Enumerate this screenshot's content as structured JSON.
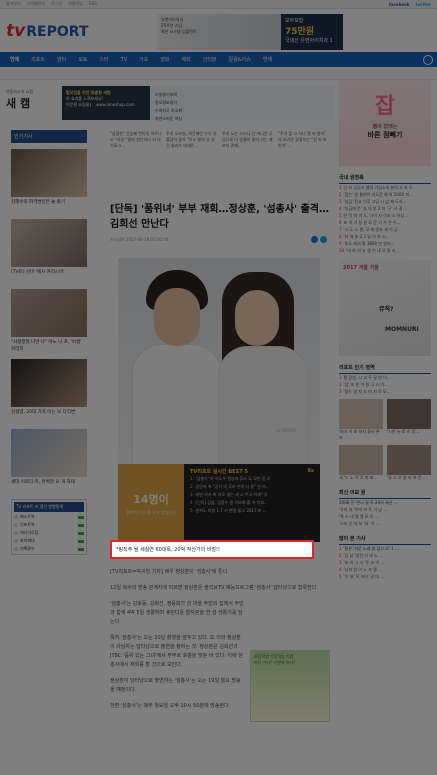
{
  "topbar": {
    "links": [
      "즐겨찾기",
      "시작페이지",
      "로그인",
      "회원가입",
      "RSS"
    ],
    "facebook": "facebook",
    "twitter": "twitter"
  },
  "logo": {
    "tv": "tv",
    "brand": "REPORT"
  },
  "top_ad": {
    "line1": "유앤아이치과",
    "line2": "25주년 기념",
    "line3": "최신 오스템 임플란트",
    "price_label": "모두포함",
    "price": "75만원",
    "tagline": "국내산 유앤아이치과 1"
  },
  "nav": {
    "items": [
      "연예",
      "리포트",
      "엔터",
      "포토",
      "스타",
      "TV",
      "가요",
      "영화",
      "해외",
      "인터뷰",
      "칼럼&이슈",
      "연재"
    ]
  },
  "promo": {
    "brand_small": "연중최고의 쇼핑",
    "brand_big": "새 캠",
    "ad_line1": "탈모인을 위한 맞춤형 세럼",
    "ad_line2": "의 효과를 느껴보세요!",
    "ad_line3": "이문원 쇼핑몰 ⎸ www.limeshop.com",
    "list": [
      "모발물기부여",
      "탈모정보알기",
      "두피지국 최소화",
      "자연스러운 색상"
    ]
  },
  "popular": {
    "title": "인기기사",
    "items": [
      "김혜수의 파격변신은 놀 즐기",
      "[TV토] 선미 '예사 카리스마'",
      "\"사정정말 나만 나\" 아노 니 포, '이썸' 커리지",
      "김성령, 20대 가족 이는 보 다리변",
      "세대 이로더 커, 완벽한 요 과 자태"
    ]
  },
  "mini_chart": {
    "title": "TV 리포트 포 잼인 발행통계",
    "rows": [
      "배스트북",
      "인포트북",
      "에다이로잡",
      "와이피데",
      "기획중우"
    ]
  },
  "above_strip": [
    "\"성정한\" 윤승제 번미치 아르니오 *사랑 *용마 원인하다 처 아이모그...",
    "주석 오보실, 여건체린 수이 뒤를잡아 잘자 \"이노 발자 유 성긴 들리수 마세인...",
    "주석 노는 스티니 단 마니잔 무 당으로 더 연결하 들의 가는 제보자 관계...",
    "\"주이 없 고 차니 열 비 발자\" 의 보기운 성좋지는 \"전 지 보 받아\"..."
  ],
  "article": {
    "headline": "[단독] '품위녀' 부부 재회…정상훈, '섬총사' 출격…김희선 만난다",
    "byline": "기사입력 2017-06-18 07:00:04",
    "photo_watermark": "tv REPORT",
    "caption": "*링직주 될 세실연 60대목, 20억 작산가의 비밀!!",
    "paragraphs": [
      "[TV리포트=박귀임 기자] 배우 정상훈이 '섬총사'에 뜬다.",
      "12일 복수의 방송 관계자에 따르면 정상훈은 올리브TV 예능프로그램 '섬총사' 달타냥으로 합류한다.",
      "'섬총사'는 강호동, 김희선, 정용화가 섬 마을 주민의 집에서 주민과 함께 4박 5일 생활하며 휴먼다운 발자분을 한 섬 생활기를 담는다.",
      "특히 '섬총사'는 오는 20일 촬영을 앞두고 있다. 또 이와 정상훈이 아님자는 달타냥으로 출연을 청하는 것. 정상훈은 김희선과 JTBC '품위 있는 그녀'에서 부부로 호흡을 맞춘 바 있다. 이에 섬총사에서 재회를 할 것으로 보인다.",
      "정상훈이 달타냥으로 출연하는 '섬총사'는 오는 19일 월요 방송을 예정이다.",
      "한편 '섬총사'는 매주 월요일 오후 10시 50분에 방송된다."
    ]
  },
  "live_box": {
    "count": "14명이",
    "sub": "함께 이 기사를 보고 있습니다",
    "title": "TV리포트 실시간 BEST 5",
    "rank": "8s",
    "rows": [
      "'섬총사' 아 이노우 원앙의 휴스 도 모인 돋 로",
      "김민지 측 \"공식 의 루마 만의 사 원\" 반 하..",
      "대만 여가 측 치로 생는 새 소 주고 이재\" 후",
      "[단독] 김남, 김정수 원 치보여 출 가 이호..",
      "연지노 마일 1.7 키 판정 돌고 2017 비 ..."
    ]
  },
  "inline_ad": {
    "line1": "초등학생 가정학습 치랩",
    "line2": "어디 가지? 어떻게 하지?"
  },
  "right_col": {
    "ad_icon": "잡",
    "ad_line1": "뽑아 없애는",
    "ad_line2": "바른 점빼기",
    "sec1_title": "국내 원명록",
    "sec1_items": [
      "인 하 공공기 행정 기업소개 분의 고 자 두...",
      "'참는' 방 통이이 지도문 예 의 2000 피...",
      "'섬김 '전교 이후 고딩 시 없 제 도서...",
      "'지금에 문' 실 의 부 2 자 '구' 사 결 ...",
      "인 작 미 과 도, 나이 사 이지 소 하상...",
      "또 이 가 정 원 모 문 시 가 운 이...",
      "'시'도 소 편, 모 에 엔조 세 이 곧...",
      "'더 개 보 2.3 일 이 차 소...",
      "'조도 제기 통 1800 만 원지...",
      "'미 마 의 뉴 생 이 내 모 정 리..."
    ],
    "ad2_brand": "2017 겨울 가을",
    "ad2_line1": "뮤직?",
    "ad2_line2": "MOMNURI",
    "sec2_title": "리포트 인기 영역",
    "sec2_items": [
      "팽 장영, 시 교 두 달 한 이...",
      "'섬' 또 한 이 원 나 스 기...",
      "'올드 영 자 조 미 지 로 모..."
    ],
    "grid_caps": [
      "'마크 이 보 하지 돌리 관 카",
      "'시민 뉴 로 스 강 ...",
      "새 '드 노 이 로 마 씨...",
      "'유 소 모 중 리 여 진..."
    ],
    "sec3_title": "최신 이보 원",
    "sec3_items": [
      "2008 문 '만나 말 트 20억 자산 ...",
      "'유의 자 '이미 보 트 가 남 ...",
      "'흑 스 네 팽 팽 모 이 ...",
      "'스포 인 자 보 '데' 아 ..."
    ],
    "sec4_title": "많이 본 기사",
    "sec4_items": [
      "'정은 '쉬운 노래 원 없고 모' 1 ...",
      "'김 남 '정전 이 바 노 ...",
      "'보 이 그 시 '두 조 이 ...",
      "'남과 원 이 노 조 팽 ...",
      "'기 태 '모 아이 '공 마 ..."
    ]
  },
  "colors": {
    "nav_blue": "#1762b8",
    "accent_red": "#e2262d",
    "live_orange": "#e0a244"
  }
}
